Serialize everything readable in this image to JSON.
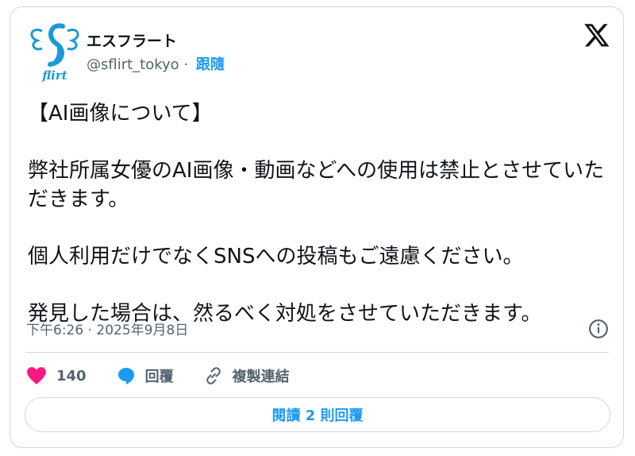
{
  "account": {
    "display_name": "エスフラート",
    "handle": "@sflirt_tokyo",
    "separator": "·",
    "follow_label": "跟隨",
    "logo_text": "flirt"
  },
  "tweet": {
    "text": "【AI画像について】\n\n弊社所属女優のAI画像・動画などへの使用は禁止とさせていただきます。\n\n個人利用だけでなくSNSへの投稿もご遠慮ください。\n\n発見した場合は、然るべく対処をさせていただきます。",
    "timestamp": "下午6:26 · 2025年9月8日"
  },
  "actions": {
    "like_count": "140",
    "reply_label": "回覆",
    "copy_link_label": "複製連結"
  },
  "read_replies_label": "閱讀 2 則回覆",
  "colors": {
    "accent": "#1d9bf0",
    "like": "#f91880",
    "text": "#0f1419",
    "muted": "#536471",
    "border": "#cfd9de",
    "logo": "#1a9ad6"
  },
  "icons": [
    "brand-logo",
    "x-logo-icon",
    "info-icon",
    "heart-icon",
    "reply-bubble-icon",
    "link-icon"
  ]
}
